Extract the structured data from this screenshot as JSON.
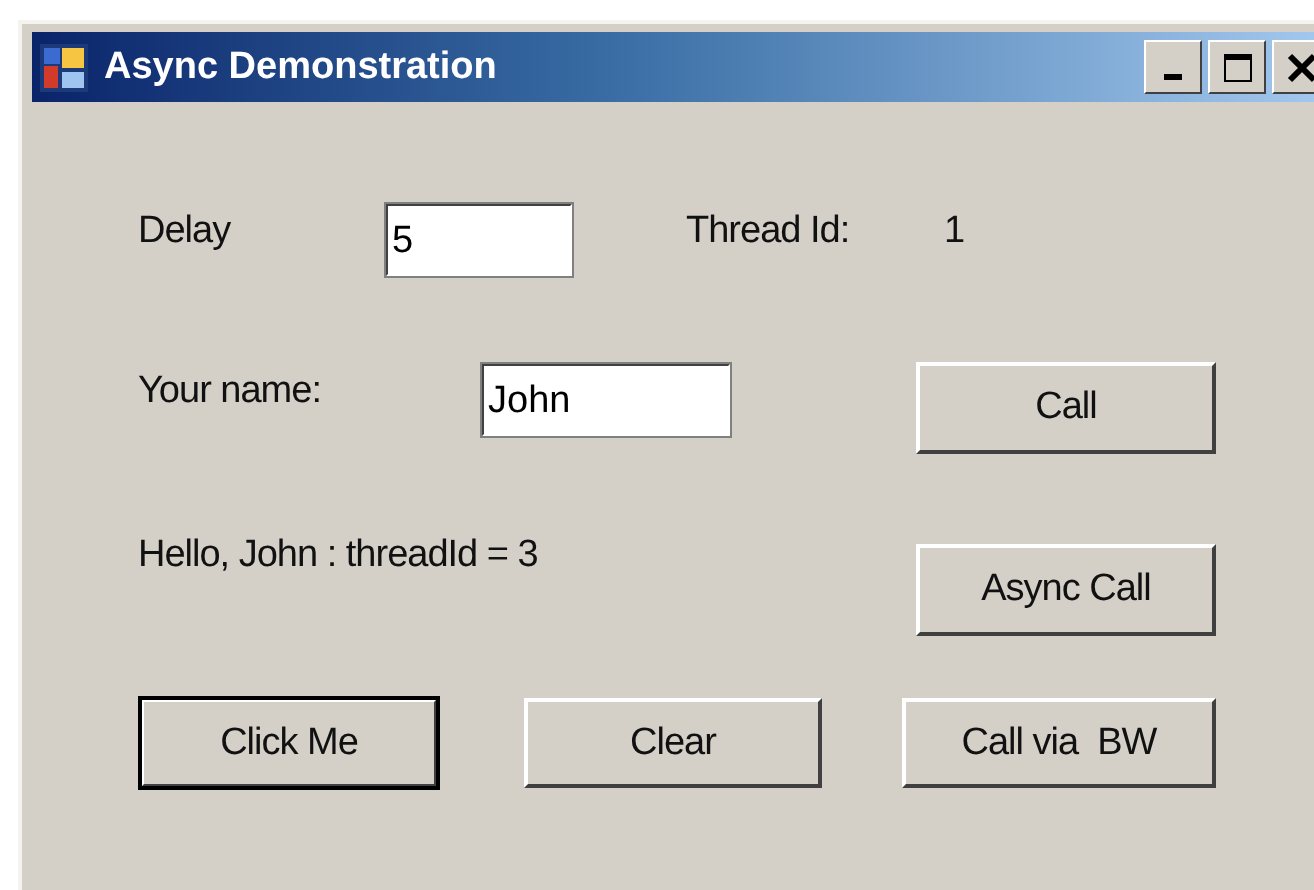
{
  "window": {
    "title": "Async Demonstration"
  },
  "delay": {
    "label": "Delay",
    "value": "5"
  },
  "thread": {
    "label": "Thread Id:",
    "value": "1"
  },
  "name": {
    "label": "Your name:",
    "value": "John"
  },
  "result": "Hello, John : threadId = 3",
  "side_buttons": [
    {
      "label": "Call",
      "default": false
    },
    {
      "label": "Async Call",
      "default": false
    }
  ],
  "bottom_buttons": [
    {
      "label": "Click Me",
      "default": true
    },
    {
      "label": "Clear",
      "default": false
    },
    {
      "label": "Call via  BW",
      "default": false
    }
  ]
}
